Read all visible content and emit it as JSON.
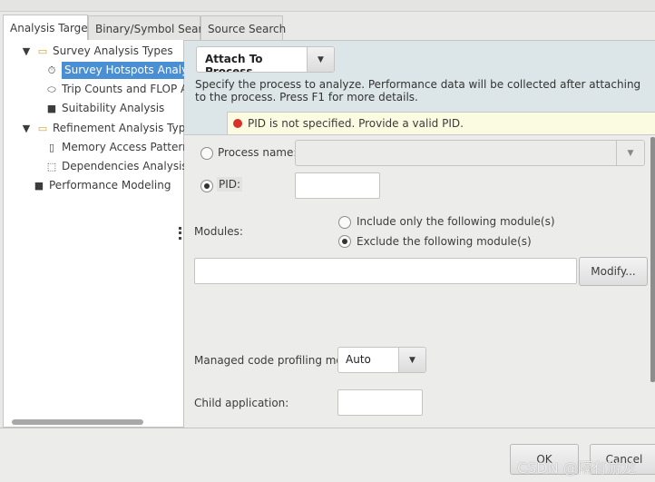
{
  "tabs": [
    {
      "label": "Analysis Target"
    },
    {
      "label": "Binary/Symbol Search"
    },
    {
      "label": "Source Search"
    }
  ],
  "tree": {
    "items": [
      {
        "label": "Survey Analysis Types",
        "icon": "folder-icon"
      },
      {
        "label": "Survey Hotspots Analysis",
        "icon": "stopwatch-icon"
      },
      {
        "label": "Trip Counts and FLOP Ana",
        "icon": "loop-icon"
      },
      {
        "label": "Suitability Analysis",
        "icon": "puzzle-icon"
      },
      {
        "label": "Refinement Analysis Types",
        "icon": "folder-icon"
      },
      {
        "label": "Memory Access Patterns A",
        "icon": "memory-icon"
      },
      {
        "label": "Dependencies Analysis",
        "icon": "dependencies-icon"
      },
      {
        "label": "Performance Modeling",
        "icon": "puzzle-icon"
      }
    ]
  },
  "launch_mode": {
    "value": "Attach To Process"
  },
  "description": "Specify the process to analyze. Performance data will be collected after attaching to the process. Press F1 for more details.",
  "warning": {
    "text": "PID is not specified. Provide a valid PID.",
    "color": "#d9302a"
  },
  "form": {
    "process_name_label": "Process name:",
    "process_name_value": "",
    "pid_label": "PID:",
    "pid_value": "",
    "modules_label": "Modules:",
    "include_label": "Include only the following module(s)",
    "exclude_label": "Exclude the following module(s)",
    "modules_value": "",
    "modify_label": "Modify...",
    "managed_label": "Managed code profiling mode:",
    "managed_value": "Auto",
    "child_label": "Child application:",
    "child_value": ""
  },
  "footer": {
    "ok_label": "OK",
    "cancel_label": "Cancel"
  },
  "watermark": "CSDN @隔有游龙",
  "colors": {
    "selection": "#4a8fd4",
    "header_bg": "#dce5e8",
    "warning_bg": "#fafbe0"
  }
}
